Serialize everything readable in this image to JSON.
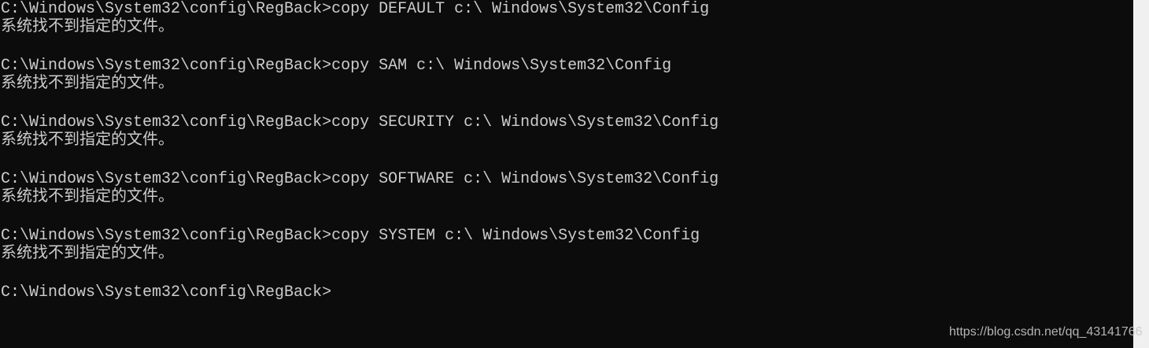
{
  "console": {
    "lines": [
      "C:\\Windows\\System32\\config\\RegBack>copy DEFAULT c:\\ Windows\\System32\\Config",
      "系统找不到指定的文件。",
      "C:\\Windows\\System32\\config\\RegBack>copy SAM c:\\ Windows\\System32\\Config",
      "系统找不到指定的文件。",
      "C:\\Windows\\System32\\config\\RegBack>copy SECURITY c:\\ Windows\\System32\\Config",
      "系统找不到指定的文件。",
      "C:\\Windows\\System32\\config\\RegBack>copy SOFTWARE c:\\ Windows\\System32\\Config",
      "系统找不到指定的文件。",
      "C:\\Windows\\System32\\config\\RegBack>copy SYSTEM c:\\ Windows\\System32\\Config",
      "系统找不到指定的文件。",
      "C:\\Windows\\System32\\config\\RegBack>"
    ]
  },
  "watermark": {
    "text": "https://blog.csdn.net/qq_43141766"
  },
  "colors": {
    "background": "#0c0c0c",
    "text": "#cccccc",
    "scrollbar": "#f0f0f0"
  }
}
